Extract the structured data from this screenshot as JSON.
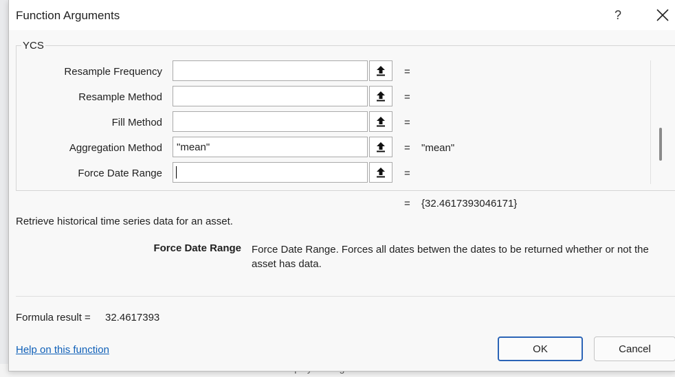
{
  "dialog": {
    "title": "Function Arguments",
    "help_glyph": "?",
    "close_icon": "close-icon",
    "group_label": "YCS",
    "arguments": [
      {
        "label": "Resample Frequency",
        "value": "",
        "result": ""
      },
      {
        "label": "Resample Method",
        "value": "",
        "result": ""
      },
      {
        "label": "Fill Method",
        "value": "",
        "result": ""
      },
      {
        "label": "Aggregation Method",
        "value": "\"mean\"",
        "result": "\"mean\""
      },
      {
        "label": "Force Date Range",
        "value": "",
        "result": ""
      }
    ],
    "equals": "=",
    "function_result": "{32.4617393046171}",
    "description": "Retrieve historical time series data for an asset.",
    "arg_help": {
      "name": "Force Date Range",
      "text": "Force Date Range. Forces all dates betwen the dates to be returned whether or not the asset has data."
    },
    "formula_result_label": "Formula result =",
    "formula_result_value": "32.4617393",
    "help_link": "Help on this function",
    "ok_label": "OK",
    "cancel_label": "Cancel",
    "collapse_icon": "upload-arrow-icon"
  },
  "background": {
    "status_text": "Display Settings"
  }
}
